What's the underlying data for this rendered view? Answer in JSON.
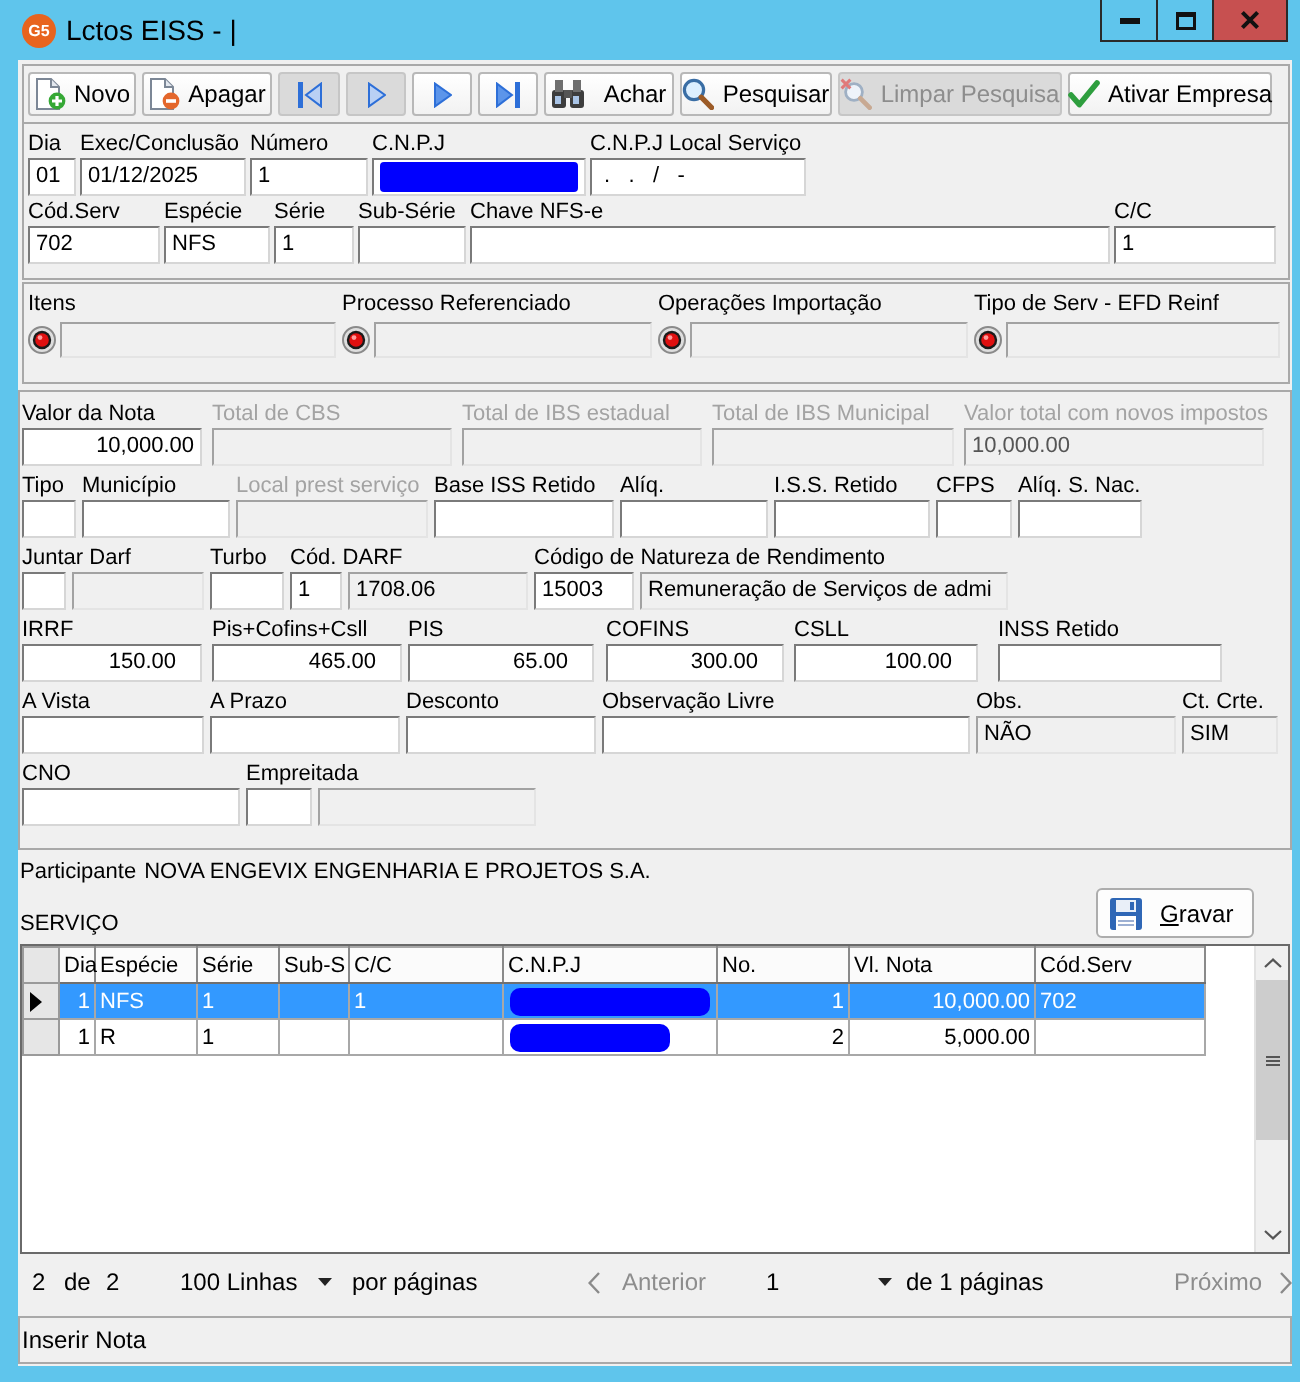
{
  "window": {
    "logo": "G5",
    "title": "Lctos EISS - |"
  },
  "toolbar": {
    "buttons": [
      {
        "kind": "new",
        "label": "Novo",
        "disabled": false
      },
      {
        "kind": "delete",
        "label": "Apagar",
        "disabled": false
      },
      {
        "kind": "first",
        "disabled": true
      },
      {
        "kind": "previous",
        "disabled": true
      },
      {
        "kind": "next",
        "disabled": false
      },
      {
        "kind": "last",
        "disabled": false
      },
      {
        "kind": "find",
        "label": "Achar",
        "disabled": false
      },
      {
        "kind": "search",
        "label": "Pesquisar",
        "disabled": false
      },
      {
        "kind": "clear",
        "label": "Limpar Pesquisa",
        "disabled": true
      },
      {
        "kind": "activate",
        "label": "Ativar Empresa",
        "disabled": false
      }
    ]
  },
  "header_form": {
    "lines": [
      {
        "fields": [
          {
            "label": "Dia",
            "value": "01",
            "readonly": false,
            "disabled": false,
            "redacted": false
          },
          {
            "label": "Exec/Conclusão",
            "value": "01/12/2025",
            "readonly": false,
            "disabled": false,
            "redacted": false
          },
          {
            "label": "Número",
            "value": "1",
            "readonly": false,
            "disabled": false,
            "redacted": false
          },
          {
            "label": "C.N.P.J",
            "readonly": false,
            "disabled": false,
            "redacted": true
          },
          {
            "label": "C.N.P.J Local Serviço",
            "value": " .   .   /   -",
            "readonly": false,
            "disabled": false,
            "redacted": false
          }
        ]
      },
      {
        "fields": [
          {
            "label": "Cód.Serv",
            "value": "702",
            "readonly": false,
            "disabled": false,
            "redacted": false
          },
          {
            "label": "Espécie",
            "value": "NFS",
            "readonly": false,
            "disabled": false,
            "redacted": false
          },
          {
            "label": "Série",
            "value": "1",
            "readonly": false,
            "disabled": false,
            "redacted": false
          },
          {
            "label": "Sub-Série",
            "readonly": false,
            "disabled": false,
            "redacted": false
          },
          {
            "label": "Chave NFS-e",
            "readonly": false,
            "disabled": false,
            "redacted": false
          },
          {
            "label": "C/C",
            "value": "1",
            "readonly": false,
            "disabled": false,
            "redacted": false
          }
        ]
      }
    ]
  },
  "references": {
    "items": [
      {
        "label": "Itens",
        "readonly": true
      },
      {
        "label": "Processo Referenciado",
        "readonly": true
      },
      {
        "label": "Operações Importação",
        "readonly": true
      },
      {
        "label": "Tipo de Serv - EFD Reinf",
        "readonly": true
      }
    ]
  },
  "values_form": {
    "lines": [
      {
        "fields": [
          {
            "label": "Valor da Nota",
            "value": "10,000.00",
            "readonly": false,
            "disabled": false,
            "redacted": false
          },
          {
            "label": "Total de CBS",
            "readonly": true,
            "disabled": true,
            "redacted": false
          },
          {
            "label": "Total de IBS estadual",
            "readonly": true,
            "disabled": true,
            "redacted": false
          },
          {
            "label": "Total de IBS Municipal",
            "readonly": true,
            "disabled": true,
            "redacted": false
          },
          {
            "label": "Valor total com novos impostos",
            "value": "10,000.00",
            "readonly": true,
            "disabled": true,
            "redacted": false
          }
        ]
      },
      {
        "fields": [
          {
            "label": "Tipo",
            "readonly": false,
            "disabled": false,
            "redacted": false
          },
          {
            "label": "Município",
            "readonly": false,
            "disabled": false,
            "redacted": false
          },
          {
            "label": "Local prest serviço",
            "readonly": true,
            "disabled": true,
            "redacted": false
          },
          {
            "label": "Base ISS Retido",
            "readonly": false,
            "disabled": false,
            "redacted": false
          },
          {
            "label": "Alíq.",
            "readonly": false,
            "disabled": false,
            "redacted": false
          },
          {
            "label": "I.S.S. Retido",
            "readonly": false,
            "disabled": false,
            "redacted": false
          },
          {
            "label": "CFPS",
            "readonly": false,
            "disabled": false,
            "redacted": false
          },
          {
            "label": "Alíq. S. Nac.",
            "readonly": false,
            "disabled": false,
            "redacted": false
          }
        ]
      },
      {
        "fields": [
          {
            "label": "Juntar Darf",
            "readonly": false,
            "disabled": false,
            "redacted": false
          },
          {
            "readonly": true,
            "disabled": false,
            "redacted": false
          },
          {
            "label": "Turbo",
            "readonly": false,
            "disabled": false,
            "redacted": false
          },
          {
            "label": "Cód. DARF",
            "value": "1",
            "readonly": false,
            "disabled": false,
            "redacted": false
          },
          {
            "value": "1708.06",
            "readonly": true,
            "disabled": false,
            "redacted": false
          },
          {
            "label": "Código de Natureza de Rendimento",
            "value": "15003",
            "readonly": false,
            "disabled": false,
            "redacted": false
          },
          {
            "value": "Remuneração de Serviços de admi",
            "readonly": true,
            "disabled": false,
            "redacted": false
          }
        ]
      },
      {
        "fields": [
          {
            "label": "IRRF",
            "value": "150.00",
            "readonly": false,
            "disabled": false,
            "redacted": false
          },
          {
            "label": "Pis+Cofins+Csll",
            "value": "465.00",
            "readonly": false,
            "disabled": false,
            "redacted": false
          },
          {
            "label": "PIS",
            "value": "65.00",
            "readonly": false,
            "disabled": false,
            "redacted": false
          },
          {
            "label": "COFINS",
            "value": "300.00",
            "readonly": false,
            "disabled": false,
            "redacted": false
          },
          {
            "label": "CSLL",
            "value": "100.00",
            "readonly": false,
            "disabled": false,
            "redacted": false
          },
          {
            "label": "INSS Retido",
            "readonly": false,
            "disabled": false,
            "redacted": false
          }
        ]
      },
      {
        "fields": [
          {
            "label": "A Vista",
            "readonly": false,
            "disabled": false,
            "redacted": false
          },
          {
            "label": "A Prazo",
            "readonly": false,
            "disabled": false,
            "redacted": false
          },
          {
            "label": "Desconto",
            "readonly": false,
            "disabled": false,
            "redacted": false
          },
          {
            "label": "Observação Livre",
            "readonly": false,
            "disabled": false,
            "redacted": false
          },
          {
            "label": "Obs.",
            "value": "NÃO",
            "readonly": true,
            "disabled": false,
            "redacted": false
          },
          {
            "label": "Ct. Crte.",
            "value": "SIM",
            "readonly": true,
            "disabled": false,
            "redacted": false
          }
        ]
      },
      {
        "fields": [
          {
            "label": "CNO",
            "readonly": false,
            "disabled": false,
            "redacted": false
          },
          {
            "label": "Empreitada",
            "readonly": false,
            "disabled": false,
            "redacted": false
          },
          {
            "readonly": true,
            "disabled": false,
            "redacted": false
          }
        ]
      }
    ]
  },
  "participant": {
    "label": "Participante",
    "name": "NOVA ENGEVIX ENGENHARIA E PROJETOS S.A."
  },
  "table": {
    "caption": "SERVIÇO",
    "save_button": {
      "label": "Gravar"
    },
    "columns": [
      "Dia",
      "Espécie",
      "Série",
      "Sub-S",
      "C/C",
      "C.N.P.J",
      "No.",
      "Vl. Nota",
      "Cód.Serv"
    ],
    "rows": [
      {
        "selected": true,
        "cells": [
          {
            "text": "1",
            "redacted": false
          },
          {
            "text": "NFS",
            "redacted": false
          },
          {
            "text": "1",
            "redacted": false
          },
          {
            "redacted": false
          },
          {
            "text": "1",
            "redacted": false
          },
          {
            "redacted": true
          },
          {
            "text": "1",
            "redacted": false
          },
          {
            "text": "10,000.00",
            "redacted": false
          },
          {
            "text": "702",
            "redacted": false
          }
        ]
      },
      {
        "selected": false,
        "cells": [
          {
            "text": "1",
            "redacted": false
          },
          {
            "text": "R",
            "redacted": false
          },
          {
            "text": "1",
            "redacted": false
          },
          {
            "redacted": false
          },
          {
            "redacted": false
          },
          {
            "redacted": true
          },
          {
            "text": "2",
            "redacted": false
          },
          {
            "text": "5,000.00",
            "redacted": false
          },
          {
            "redacted": false
          }
        ]
      }
    ]
  },
  "pager": {
    "shown": "2",
    "of": "de",
    "total": "2",
    "page_size": "100 Linhas",
    "per_page": "por páginas",
    "previous": {
      "label": "Anterior",
      "disabled": true
    },
    "page": "1",
    "page_count": "de 1 páginas",
    "next": {
      "label": "Próximo",
      "disabled": true
    }
  },
  "status_bar": {
    "text": "Inserir Nota"
  }
}
